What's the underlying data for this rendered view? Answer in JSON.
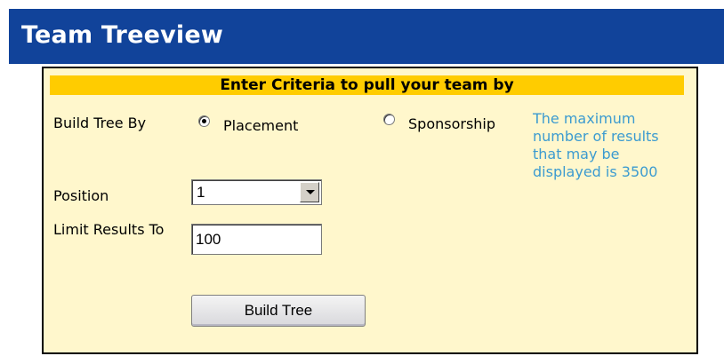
{
  "header": {
    "title": "Team Treeview"
  },
  "panel": {
    "criteria_title": "Enter Criteria to pull your team by",
    "build_tree_by": {
      "label": "Build Tree By",
      "options": [
        {
          "label": "Placement",
          "selected": true
        },
        {
          "label": "Sponsorship",
          "selected": false
        }
      ]
    },
    "info_text": "The maximum number of results that may be displayed is 3500",
    "position": {
      "label": "Position",
      "value": "1"
    },
    "limit": {
      "label": "Limit Results To",
      "value": "100"
    },
    "build_button": "Build Tree"
  },
  "colors": {
    "header_bg": "#11439a",
    "panel_bg": "#fff7cc",
    "criteria_bar": "#ffcc00",
    "info_text": "#3c9bd0"
  },
  "icons": {
    "dropdown_arrow": "chevron-down-icon",
    "radio_selected": "radio-selected-icon",
    "radio_unselected": "radio-unselected-icon"
  }
}
